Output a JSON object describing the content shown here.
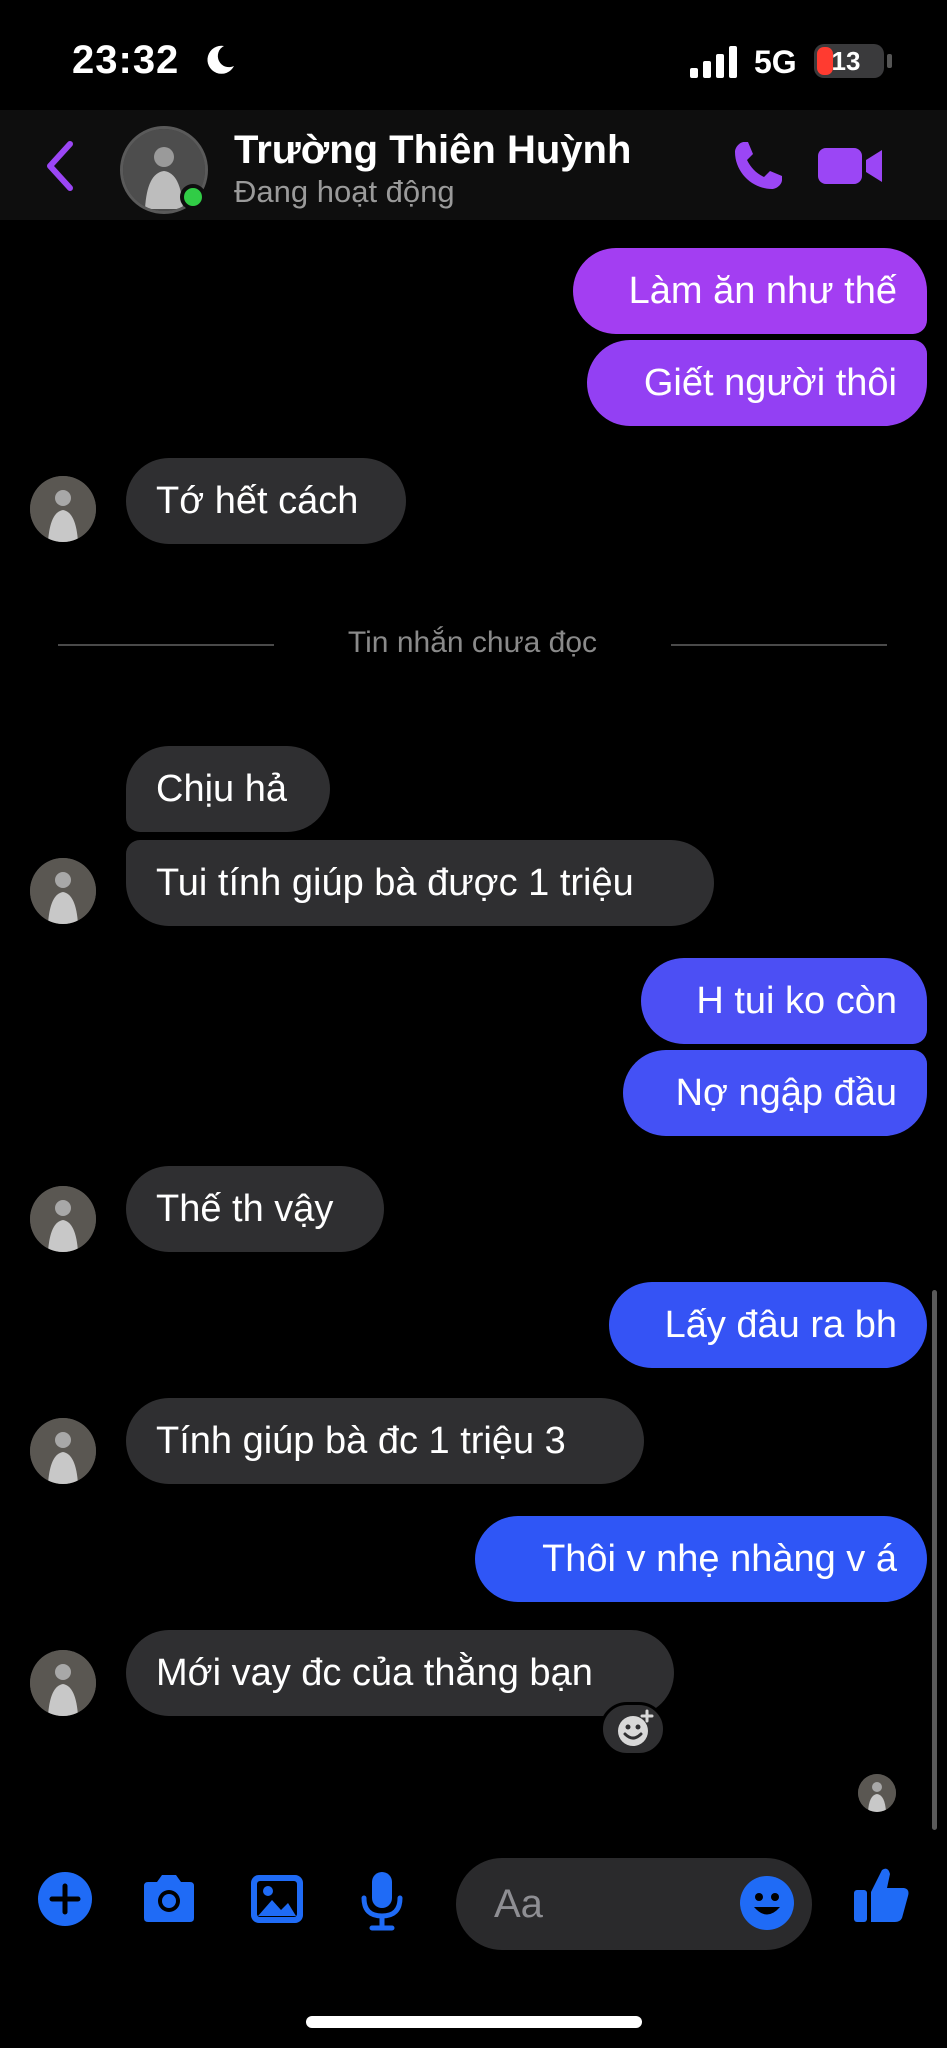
{
  "status_bar": {
    "time": "23:32",
    "network": "5G",
    "battery": "13"
  },
  "header": {
    "contact_name": "Trường Thiên Huỳnh",
    "status": "Đang hoạt động"
  },
  "colors": {
    "gradient_top": "#a33ef2",
    "gradient_mid": "#6a4bf3",
    "gradient_bottom": "#2f56f6",
    "accent": "#9b46f5",
    "icon_blue": "#1f6bf6",
    "online": "#31cc46"
  },
  "messages": [
    {
      "side": "out",
      "text": "Làm ăn như thế"
    },
    {
      "side": "out",
      "text": "Giết người thôi"
    },
    {
      "side": "in",
      "text": "Tớ hết cách"
    },
    {
      "side": "in",
      "text": "Chịu hả"
    },
    {
      "side": "in",
      "text": "Tui tính giúp bà được 1 triệu"
    },
    {
      "side": "out",
      "text": "H tui ko còn"
    },
    {
      "side": "out",
      "text": "Nợ ngập đầu"
    },
    {
      "side": "in",
      "text": "Thế th vậy"
    },
    {
      "side": "out",
      "text": "Lấy đâu ra bh"
    },
    {
      "side": "in",
      "text": "Tính giúp bà đc 1 triệu 3"
    },
    {
      "side": "out",
      "text": "Thôi v nhẹ nhàng v á"
    },
    {
      "side": "in",
      "text": "Mới vay đc của thằng bạn"
    }
  ],
  "unread_divider": "Tin nhắn chưa đọc",
  "composer": {
    "placeholder": "Aa"
  },
  "icons": [
    "moon-icon",
    "signal-icon",
    "back-icon",
    "phone-icon",
    "video-icon",
    "plus-icon",
    "camera-icon",
    "image-icon",
    "mic-icon",
    "emoji-icon",
    "like-icon",
    "add-reaction-icon"
  ]
}
